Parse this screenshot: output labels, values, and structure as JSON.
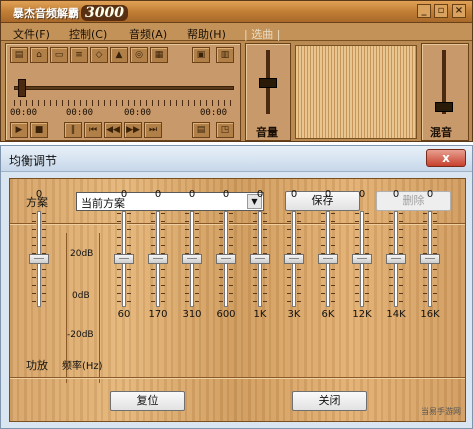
{
  "player": {
    "title": "暴杰音频解霸",
    "logo_text": "3000",
    "menus": [
      "文件(F)",
      "控制(C)",
      "音频(A)",
      "帮助(H)"
    ],
    "menu_disabled": "| 选曲 |",
    "time_left": "00:00",
    "time_mid1": "00:00",
    "time_mid2": "00:00",
    "time_right": "00:00",
    "volume_label": "音量",
    "reverb_label": "混音"
  },
  "equalizer": {
    "title": "均衡调节",
    "close_glyph": "x",
    "preset_label": "方案",
    "preset_value": "当前方案",
    "save_label": "保存",
    "delete_label": "删除",
    "db_top": "20dB",
    "db_mid": "0dB",
    "db_bottom": "-20dB",
    "power_label": "功放",
    "freq_header": "频率(Hz)",
    "bands": [
      {
        "name": "power",
        "value": "0",
        "freq": ""
      },
      {
        "name": "60",
        "value": "0",
        "freq": "60"
      },
      {
        "name": "170",
        "value": "0",
        "freq": "170"
      },
      {
        "name": "310",
        "value": "0",
        "freq": "310"
      },
      {
        "name": "600",
        "value": "0",
        "freq": "600"
      },
      {
        "name": "1K",
        "value": "0",
        "freq": "1K"
      },
      {
        "name": "3K",
        "value": "0",
        "freq": "3K"
      },
      {
        "name": "6K",
        "value": "0",
        "freq": "6K"
      },
      {
        "name": "12K",
        "value": "0",
        "freq": "12K"
      },
      {
        "name": "14K",
        "value": "0",
        "freq": "14K"
      },
      {
        "name": "16K",
        "value": "0",
        "freq": "16K"
      }
    ],
    "reset_label": "复位",
    "close_label": "关闭",
    "watermark": "当易手游网"
  },
  "colors": {
    "wood": "#d6a56a",
    "accent_close": "#c8402e"
  }
}
